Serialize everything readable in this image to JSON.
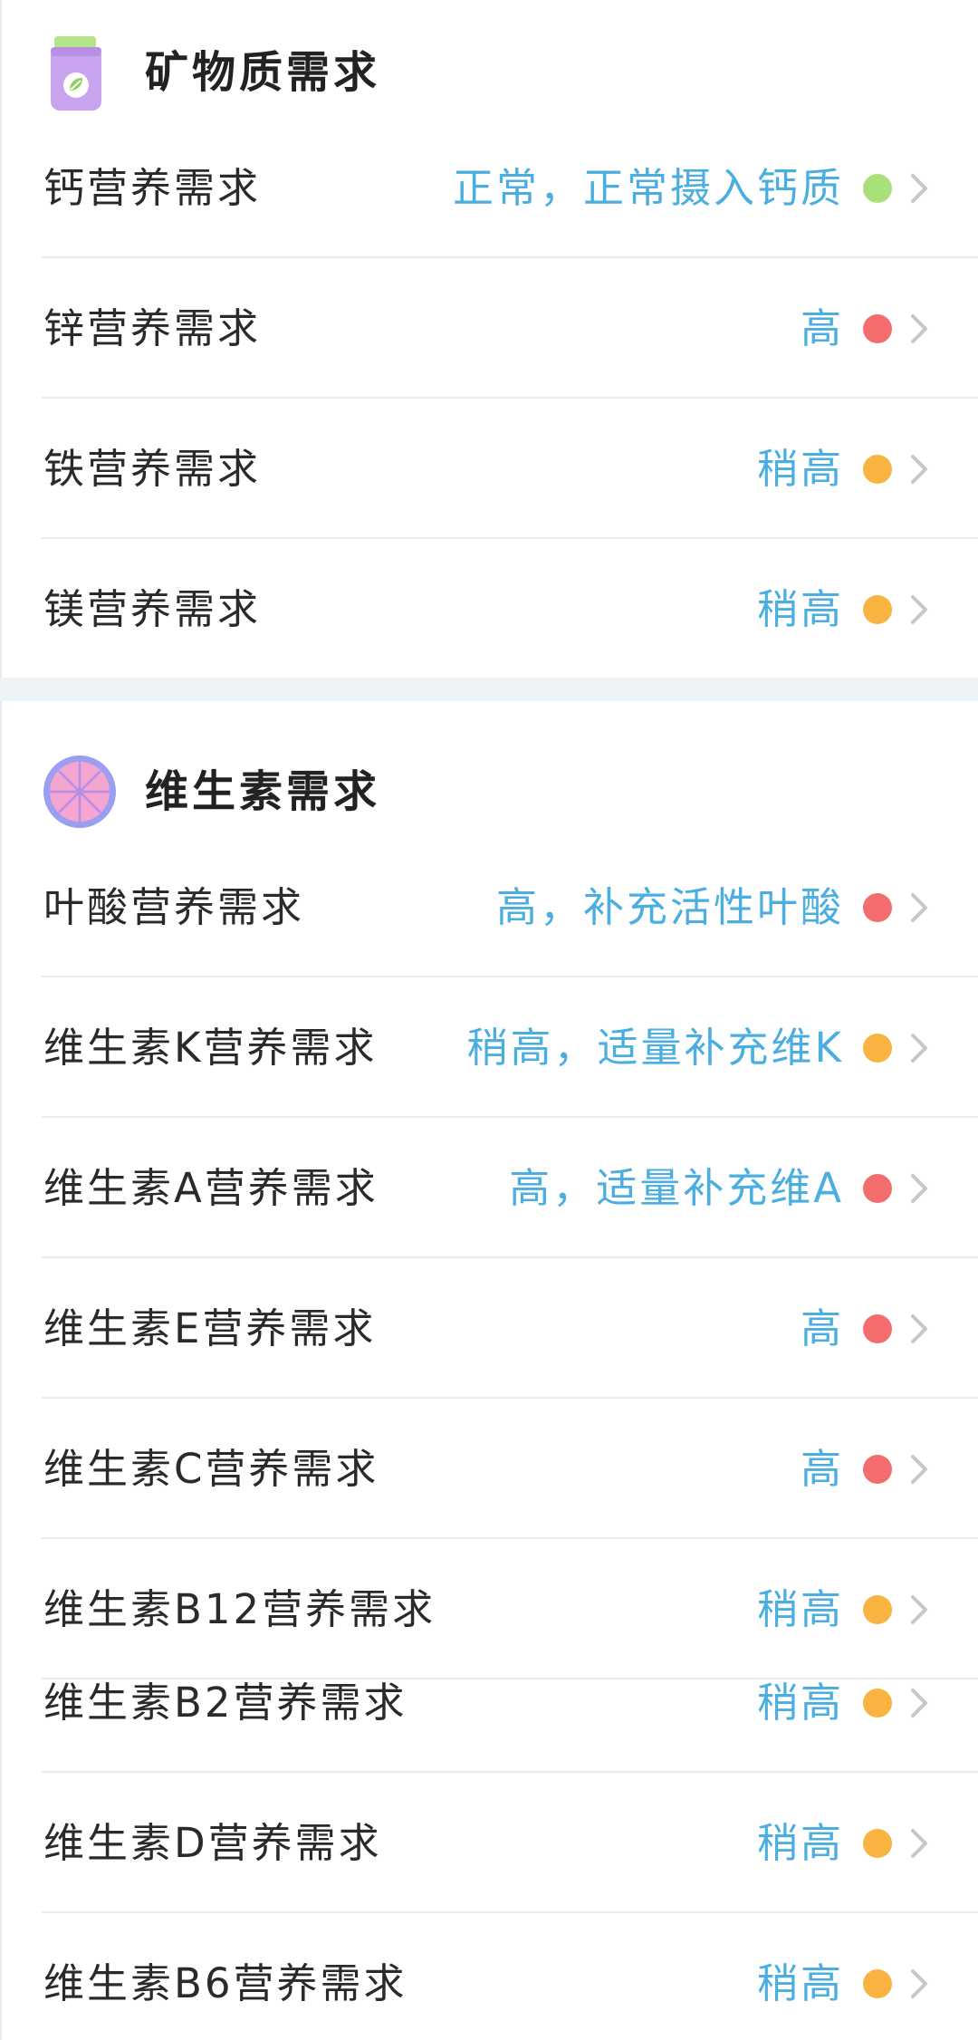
{
  "minerals": {
    "title": "矿物质需求",
    "icon": "supplement-bottle-icon",
    "rows": [
      {
        "label": "钙营养需求",
        "value": "正常，正常摄入钙质",
        "status": "normal"
      },
      {
        "label": "锌营养需求",
        "value": "高",
        "status": "high"
      },
      {
        "label": "铁营养需求",
        "value": "稍高",
        "status": "slightly-high"
      },
      {
        "label": "镁营养需求",
        "value": "稍高",
        "status": "slightly-high"
      }
    ]
  },
  "vitamins": {
    "title": "维生素需求",
    "icon": "citrus-slice-icon",
    "rows": [
      {
        "label": "叶酸营养需求",
        "value": "高，补充活性叶酸",
        "status": "high"
      },
      {
        "label": "维生素K营养需求",
        "value": "稍高，适量补充维K",
        "status": "slightly-high"
      },
      {
        "label": "维生素A营养需求",
        "value": "高，适量补充维A",
        "status": "high"
      },
      {
        "label": "维生素E营养需求",
        "value": "高",
        "status": "high"
      },
      {
        "label": "维生素C营养需求",
        "value": "高",
        "status": "high"
      },
      {
        "label": "维生素B12营养需求",
        "value": "稍高",
        "status": "slightly-high"
      },
      {
        "label": "维生素B2营养需求",
        "value": "稍高",
        "status": "slightly-high"
      },
      {
        "label": "维生素D营养需求",
        "value": "稍高",
        "status": "slightly-high"
      },
      {
        "label": "维生素B6营养需求",
        "value": "稍高",
        "status": "slightly-high"
      }
    ]
  },
  "colors": {
    "value_text": "#4aaee0",
    "status_normal": "#a9e07a",
    "status_high": "#f46d6d",
    "status_slightly_high": "#f8b341",
    "chevron": "#c8c8c8",
    "section_gap": "#eef3f8"
  }
}
